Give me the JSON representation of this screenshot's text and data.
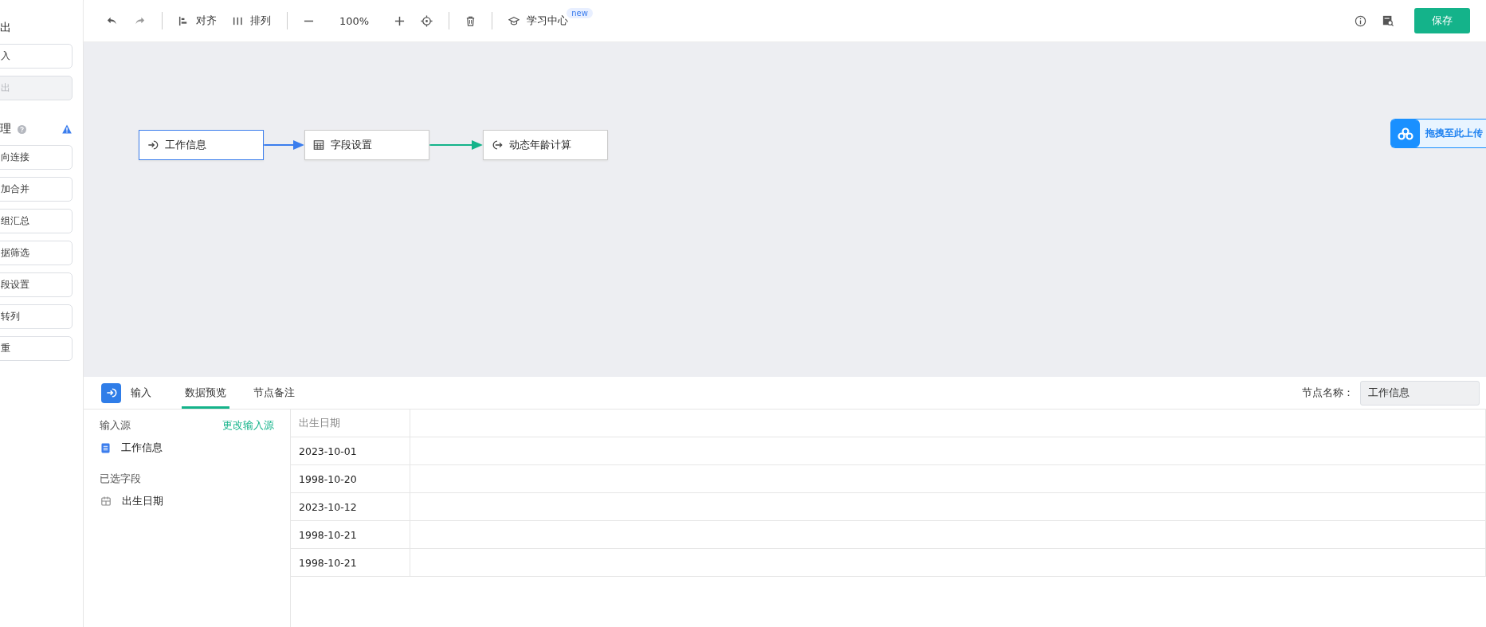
{
  "sidebar": {
    "sections": [
      {
        "title": "出",
        "items": [
          {
            "label": "入",
            "disabled": false
          },
          {
            "label": "出",
            "disabled": true
          }
        ]
      },
      {
        "title": "理",
        "items": [
          {
            "label": "向连接",
            "disabled": false
          },
          {
            "label": "加合并",
            "disabled": false
          },
          {
            "label": "组汇总",
            "disabled": false
          },
          {
            "label": "据筛选",
            "disabled": false
          },
          {
            "label": "段设置",
            "disabled": false
          },
          {
            "label": "转列",
            "disabled": false
          },
          {
            "label": "重",
            "disabled": false
          }
        ]
      }
    ]
  },
  "toolbar": {
    "align": "对齐",
    "arrange": "排列",
    "zoom": "100%",
    "learn": "学习中心",
    "badge": "new",
    "save": "保存"
  },
  "canvas": {
    "nodes": [
      {
        "label": "工作信息",
        "kind": "input",
        "selected": true
      },
      {
        "label": "字段设置",
        "kind": "table",
        "selected": false
      },
      {
        "label": "动态年龄计算",
        "kind": "output",
        "selected": false
      }
    ],
    "edges": [
      {
        "color": "#3b7ded"
      },
      {
        "color": "#14b38a"
      }
    ],
    "upload": "拖拽至此上传"
  },
  "panel": {
    "node_type": "输入",
    "tabs": [
      {
        "label": "数据预览",
        "selected": true
      },
      {
        "label": "节点备注",
        "selected": false
      }
    ],
    "node_name_label": "节点名称：",
    "node_name": "工作信息",
    "source_label": "输入源",
    "change_link": "更改输入源",
    "source": "工作信息",
    "fields_label": "已选字段",
    "fields": [
      "出生日期"
    ],
    "table": {
      "columns": [
        "出生日期"
      ],
      "rows": [
        [
          "2023-10-01"
        ],
        [
          "1998-10-20"
        ],
        [
          "2023-10-12"
        ],
        [
          "1998-10-21"
        ],
        [
          "1998-10-21"
        ]
      ]
    }
  }
}
